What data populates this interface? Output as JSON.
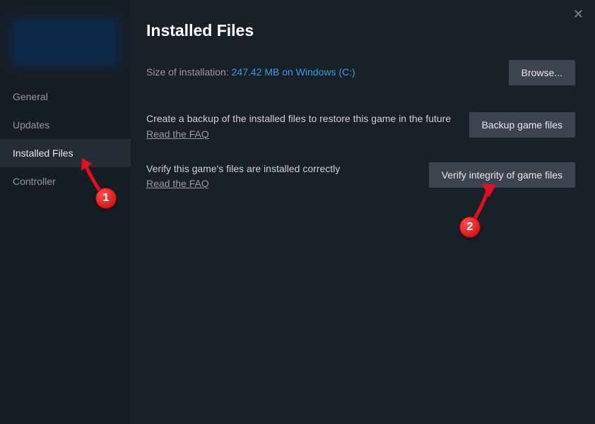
{
  "sidebar": {
    "items": [
      {
        "label": "General"
      },
      {
        "label": "Updates"
      },
      {
        "label": "Installed Files"
      },
      {
        "label": "Controller"
      }
    ]
  },
  "header": {
    "title": "Installed Files"
  },
  "install_size": {
    "label": "Size of installation: ",
    "value": "247.42 MB on Windows (C:)",
    "browse_label": "Browse..."
  },
  "backup": {
    "description": "Create a backup of the installed files to restore this game in the future",
    "faq_label": "Read the FAQ",
    "button_label": "Backup game files"
  },
  "verify": {
    "description": "Verify this game's files are installed correctly",
    "faq_label": "Read the FAQ",
    "button_label": "Verify integrity of game files"
  },
  "annotations": {
    "badge1": "1",
    "badge2": "2"
  }
}
